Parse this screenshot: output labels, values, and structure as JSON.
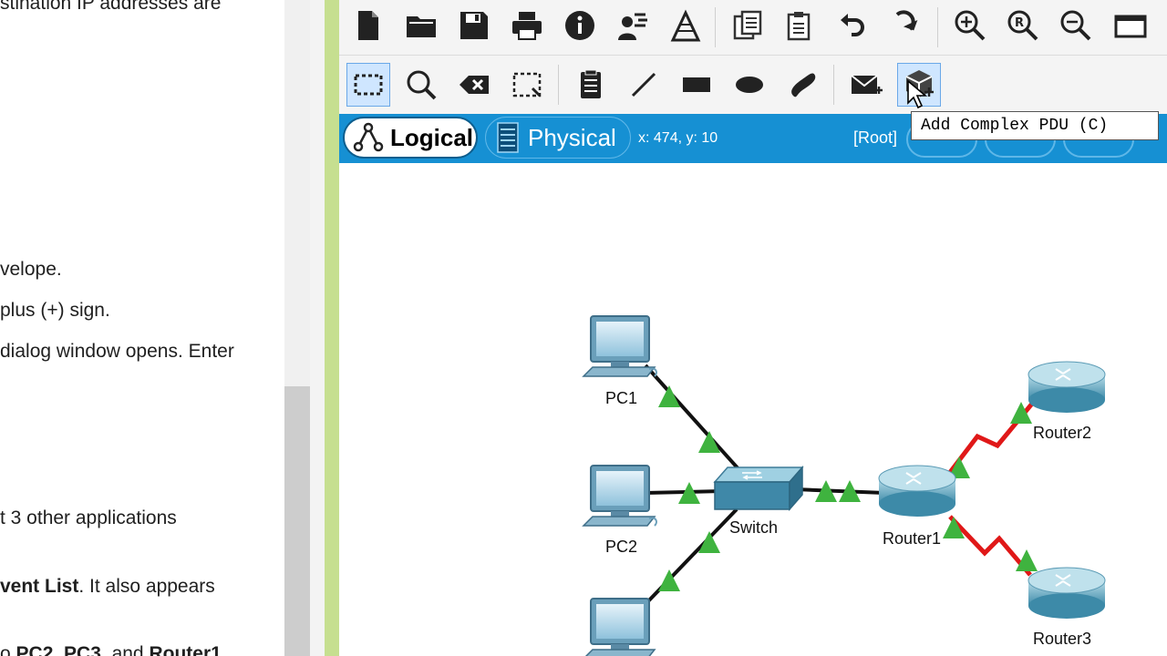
{
  "instructions": {
    "lines": [
      {
        "pre": "stination IP addresses are",
        "bold": "",
        "post": ""
      },
      {
        "pre": "velope.",
        "bold": "",
        "post": ""
      },
      {
        "pre": "plus (+) sign.",
        "bold": "",
        "post": ""
      },
      {
        "pre": "dialog window opens. Enter",
        "bold": "",
        "post": ""
      },
      {
        "pre": "t 3 other applications",
        "bold": "",
        "post": ""
      },
      {
        "pre": "",
        "bold": "vent List",
        "post": ". It also appears"
      },
      {
        "pre": "o ",
        "bold": "PC2",
        "post": ", "
      },
      {
        "pre": "",
        "bold": "PC3",
        "post": ", and "
      },
      {
        "pre": "",
        "bold": "Router1",
        "post": ""
      }
    ]
  },
  "toolbar1": {
    "items": [
      {
        "name": "new-file-icon",
        "icon": "new"
      },
      {
        "name": "open-folder-icon",
        "icon": "open"
      },
      {
        "name": "save-icon",
        "icon": "save"
      },
      {
        "name": "print-icon",
        "icon": "print"
      },
      {
        "name": "info-icon",
        "icon": "info"
      },
      {
        "name": "activity-wizard-icon",
        "icon": "wizard"
      },
      {
        "name": "network-info-icon",
        "icon": "netinfo"
      },
      {
        "name": "copy-icon",
        "icon": "copy"
      },
      {
        "name": "paste-icon",
        "icon": "paste"
      },
      {
        "name": "undo-icon",
        "icon": "undo"
      },
      {
        "name": "redo-icon",
        "icon": "redo"
      },
      {
        "name": "zoom-in-icon",
        "icon": "zoomin"
      },
      {
        "name": "zoom-reset-icon",
        "icon": "zoomreset"
      },
      {
        "name": "zoom-out-icon",
        "icon": "zoomout"
      },
      {
        "name": "window-icon",
        "icon": "window"
      }
    ]
  },
  "toolbar2": {
    "items": [
      {
        "name": "select-icon",
        "icon": "select"
      },
      {
        "name": "inspect-icon",
        "icon": "inspect"
      },
      {
        "name": "delete-icon",
        "icon": "delete"
      },
      {
        "name": "resize-shape-icon",
        "icon": "resize"
      },
      {
        "name": "place-note-icon",
        "icon": "note"
      },
      {
        "name": "draw-line-icon",
        "icon": "line"
      },
      {
        "name": "draw-rectangle-icon",
        "icon": "rect"
      },
      {
        "name": "draw-ellipse-icon",
        "icon": "ellipse"
      },
      {
        "name": "freeform-icon",
        "icon": "freeform"
      },
      {
        "name": "add-simple-pdu-icon",
        "icon": "simplepdu"
      },
      {
        "name": "add-complex-pdu-icon",
        "icon": "complexpdu"
      }
    ]
  },
  "modebar": {
    "logical_label": "Logical",
    "physical_label": "Physical",
    "coords": "x: 474, y: 10",
    "root_label": "[Root]"
  },
  "tooltip": {
    "text": "Add Complex PDU (C)"
  },
  "colors": {
    "modebar_blue": "#1690d3",
    "ethernet_link": "#111111",
    "serial_link": "#e01818",
    "link_up": "#3fb33f",
    "pt_border": "#c6df90"
  },
  "topology": {
    "devices": [
      {
        "id": "pc1",
        "type": "pc",
        "label": "PC1"
      },
      {
        "id": "pc2",
        "type": "pc",
        "label": "PC2"
      },
      {
        "id": "pc3",
        "type": "pc",
        "label": ""
      },
      {
        "id": "switch",
        "type": "switch",
        "label": "Switch"
      },
      {
        "id": "router1",
        "type": "router",
        "label": "Router1"
      },
      {
        "id": "router2",
        "type": "router",
        "label": "Router2"
      },
      {
        "id": "router3",
        "type": "router",
        "label": "Router3"
      }
    ],
    "links": [
      {
        "from": "pc1",
        "to": "switch",
        "kind": "ethernet"
      },
      {
        "from": "pc2",
        "to": "switch",
        "kind": "ethernet"
      },
      {
        "from": "pc3",
        "to": "switch",
        "kind": "ethernet"
      },
      {
        "from": "switch",
        "to": "router1",
        "kind": "ethernet"
      },
      {
        "from": "router1",
        "to": "router2",
        "kind": "serial"
      },
      {
        "from": "router1",
        "to": "router3",
        "kind": "serial"
      }
    ]
  }
}
